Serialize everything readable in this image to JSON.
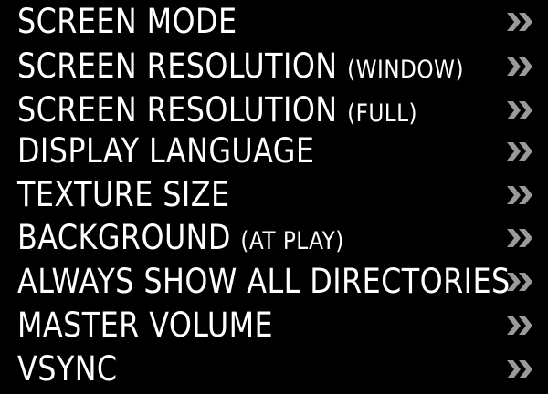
{
  "menu": {
    "items": [
      {
        "label": "SCREEN MODE",
        "sub": ""
      },
      {
        "label": "SCREEN RESOLUTION",
        "sub": "(WINDOW)"
      },
      {
        "label": "SCREEN RESOLUTION",
        "sub": "(FULL)"
      },
      {
        "label": "DISPLAY LANGUAGE",
        "sub": ""
      },
      {
        "label": "TEXTURE SIZE",
        "sub": ""
      },
      {
        "label": "BACKGROUND",
        "sub": "(AT PLAY)"
      },
      {
        "label": "ALWAYS SHOW ALL DIRECTORIES",
        "sub": ""
      },
      {
        "label": "MASTER VOLUME",
        "sub": ""
      },
      {
        "label": "VSYNC",
        "sub": ""
      }
    ],
    "chevron_icon": "double-chevron-right-icon",
    "colors": {
      "background": "#000000",
      "text": "#ffffff",
      "chevron": "#9a9a9a"
    }
  }
}
